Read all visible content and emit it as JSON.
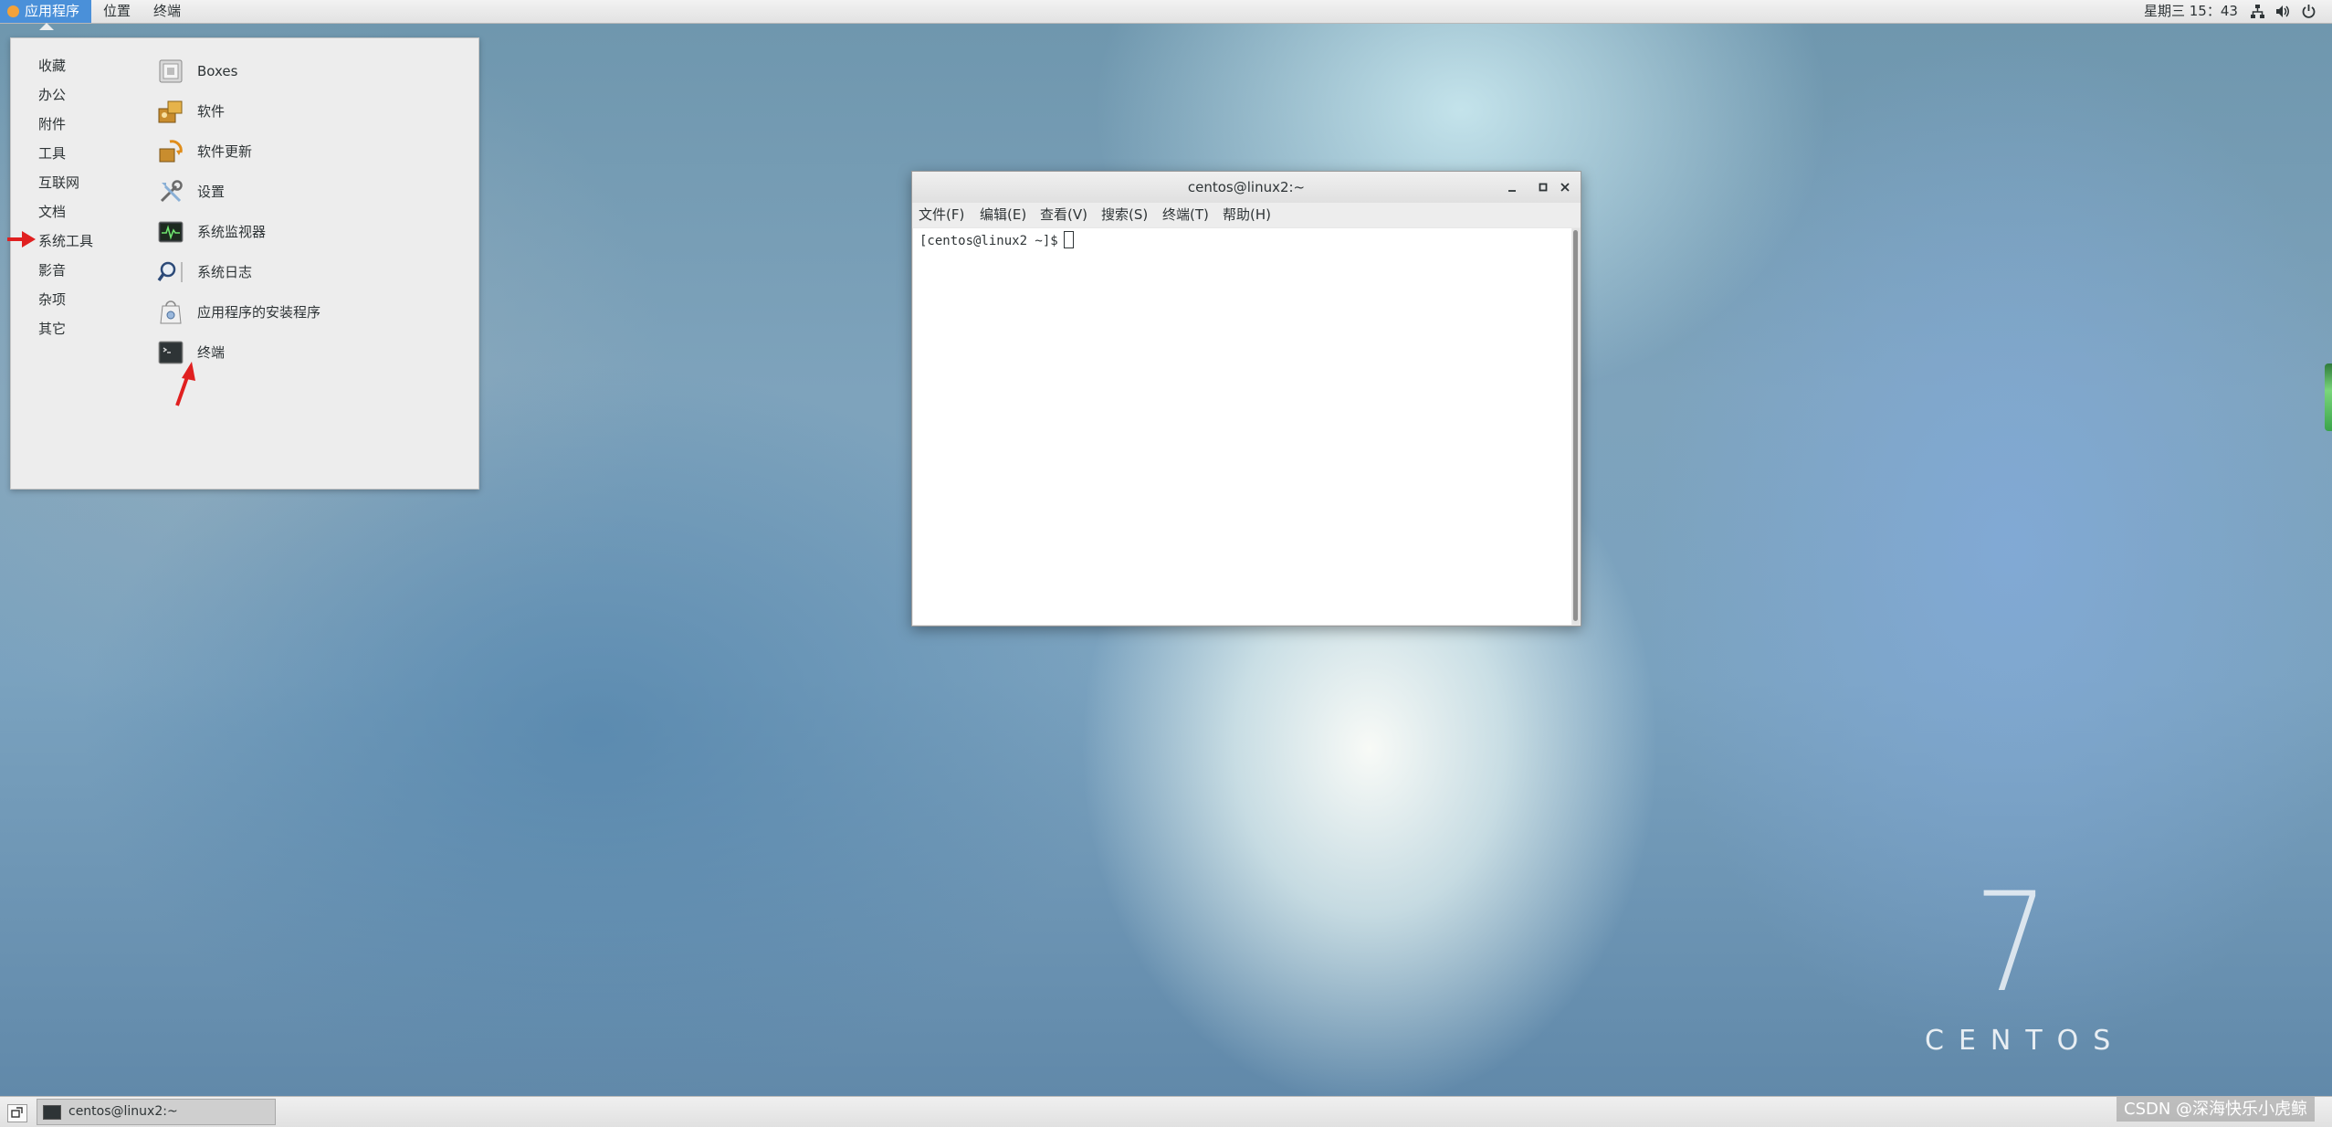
{
  "top_panel": {
    "applications": "应用程序",
    "places": "位置",
    "terminal": "终端",
    "clock": "星期三 15：43",
    "tray": {
      "network_icon": "network-icon",
      "volume_icon": "volume-icon",
      "power_icon": "power-icon"
    }
  },
  "apps_menu": {
    "categories": [
      "收藏",
      "办公",
      "附件",
      "工具",
      "互联网",
      "文档",
      "系统工具",
      "影音",
      "杂项",
      "其它"
    ],
    "items": [
      {
        "label": "Boxes",
        "icon": "boxes-icon"
      },
      {
        "label": "软件",
        "icon": "software-icon"
      },
      {
        "label": "软件更新",
        "icon": "software-update-icon"
      },
      {
        "label": "设置",
        "icon": "settings-icon"
      },
      {
        "label": "系统监视器",
        "icon": "system-monitor-icon"
      },
      {
        "label": "系统日志",
        "icon": "system-log-icon"
      },
      {
        "label": "应用程序的安装程序",
        "icon": "app-installer-icon"
      },
      {
        "label": "终端",
        "icon": "terminal-icon"
      }
    ]
  },
  "terminal_window": {
    "title": "centos@linux2:~",
    "menu": [
      "文件(F)",
      "编辑(E)",
      "查看(V)",
      "搜索(S)",
      "终端(T)",
      "帮助(H)"
    ],
    "prompt": "[centos@linux2 ~]$"
  },
  "desktop": {
    "logo_number": "7",
    "logo_word": "CENTOS"
  },
  "bottom_panel": {
    "task_label": "centos@linux2:~",
    "watermark": "CSDN @深海快乐小虎鲸"
  },
  "colors": {
    "accent": "#4a90d9",
    "annotation_red": "#e02020"
  }
}
